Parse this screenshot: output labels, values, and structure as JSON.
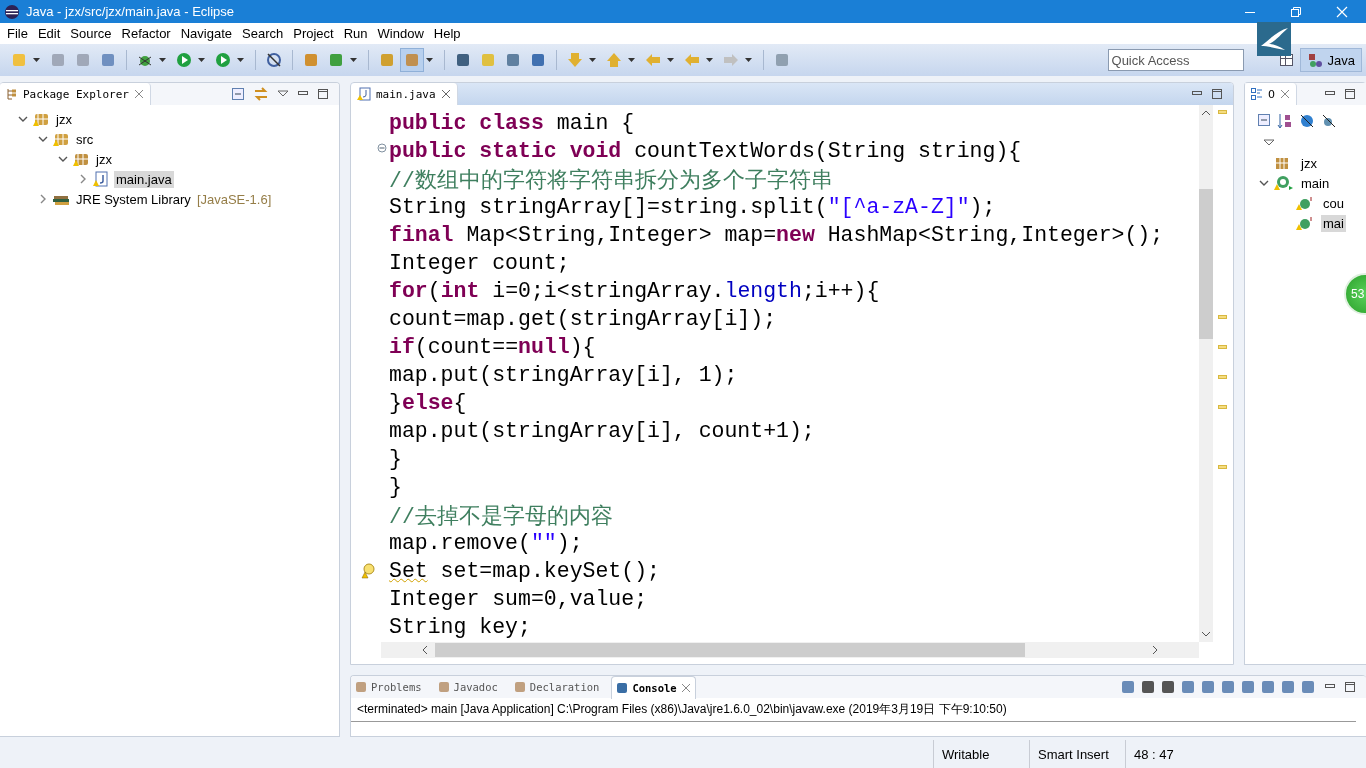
{
  "window": {
    "title": "Java - jzx/src/jzx/main.java - Eclipse"
  },
  "menu": [
    "File",
    "Edit",
    "Source",
    "Refactor",
    "Navigate",
    "Search",
    "Project",
    "Run",
    "Window",
    "Help"
  ],
  "quick_access": {
    "placeholder": "Quick Access"
  },
  "perspective": {
    "label": "Java",
    "selected": true
  },
  "package_explorer": {
    "tab": "Package Explorer",
    "tree": [
      {
        "label": "jzx",
        "kind": "project",
        "expanded": true,
        "selected": false,
        "children": [
          {
            "label": "src",
            "kind": "source-folder",
            "expanded": true,
            "selected": false,
            "children": [
              {
                "label": "jzx",
                "kind": "package",
                "expanded": true,
                "selected": false,
                "children": [
                  {
                    "label": "main.java",
                    "kind": "java-file",
                    "expanded": false,
                    "selected": true
                  }
                ]
              }
            ]
          },
          {
            "label": "JRE System Library",
            "suffix": "[JavaSE-1.6]",
            "kind": "library",
            "expanded": false,
            "selected": false
          }
        ]
      }
    ]
  },
  "editor": {
    "tab": "main.java",
    "lines": [
      {
        "tokens": [
          {
            "kind": "keyword",
            "text": "public class"
          },
          {
            "kind": "plain",
            "text": " main {"
          }
        ]
      },
      {
        "kind": "fold",
        "tokens": [
          {
            "kind": "keyword",
            "text": "public static void"
          },
          {
            "kind": "plain",
            "text": " countTextWords(String string){"
          }
        ]
      },
      {
        "tokens": [
          {
            "kind": "comment",
            "text": "//数组中的字符将字符串拆分为多个子字符串"
          }
        ]
      },
      {
        "tokens": [
          {
            "kind": "plain",
            "text": "String stringArray[]=string.split("
          },
          {
            "kind": "string",
            "text": "\"[^a-zA-Z]\""
          },
          {
            "kind": "plain",
            "text": ");"
          }
        ]
      },
      {
        "tokens": [
          {
            "kind": "keyword",
            "text": "final"
          },
          {
            "kind": "plain",
            "text": " Map<String,Integer> map="
          },
          {
            "kind": "keyword",
            "text": "new"
          },
          {
            "kind": "plain",
            "text": " HashMap<String,Integer>();"
          }
        ]
      },
      {
        "tokens": [
          {
            "kind": "plain",
            "text": "Integer count;"
          }
        ]
      },
      {
        "tokens": [
          {
            "kind": "keyword",
            "text": "for"
          },
          {
            "kind": "plain",
            "text": "("
          },
          {
            "kind": "keyword",
            "text": "int"
          },
          {
            "kind": "plain",
            "text": " i=0;i<stringArray."
          },
          {
            "kind": "field",
            "text": "length"
          },
          {
            "kind": "plain",
            "text": ";i++){"
          }
        ]
      },
      {
        "tokens": [
          {
            "kind": "plain",
            "text": "count=map.get(stringArray[i]);"
          }
        ]
      },
      {
        "tokens": [
          {
            "kind": "keyword",
            "text": "if"
          },
          {
            "kind": "plain",
            "text": "(count=="
          },
          {
            "kind": "keyword",
            "text": "null"
          },
          {
            "kind": "plain",
            "text": "){"
          }
        ]
      },
      {
        "tokens": [
          {
            "kind": "plain",
            "text": "map.put(stringArray[i], 1);"
          }
        ]
      },
      {
        "tokens": [
          {
            "kind": "plain",
            "text": "}"
          },
          {
            "kind": "keyword",
            "text": "else"
          },
          {
            "kind": "plain",
            "text": "{"
          }
        ]
      },
      {
        "tokens": [
          {
            "kind": "plain",
            "text": "map.put(stringArray[i], count+1);"
          }
        ]
      },
      {
        "tokens": [
          {
            "kind": "plain",
            "text": "}"
          }
        ]
      },
      {
        "tokens": [
          {
            "kind": "plain",
            "text": "}"
          }
        ]
      },
      {
        "tokens": [
          {
            "kind": "comment",
            "text": "//去掉不是字母的内容"
          }
        ]
      },
      {
        "tokens": [
          {
            "kind": "plain",
            "text": "map.remove("
          },
          {
            "kind": "string",
            "text": "\"\""
          },
          {
            "kind": "plain",
            "text": ");"
          }
        ]
      },
      {
        "kind": "warning",
        "tokens": [
          {
            "kind": "warned",
            "text": "Set"
          },
          {
            "kind": "plain",
            "text": " set=map.keySet();"
          }
        ]
      },
      {
        "tokens": [
          {
            "kind": "plain",
            "text": "Integer sum=0,value;"
          }
        ]
      },
      {
        "tokens": [
          {
            "kind": "plain",
            "text": "String key;"
          }
        ]
      }
    ]
  },
  "outline": {
    "tab": "0",
    "tree": [
      {
        "label": "jzx",
        "kind": "package",
        "selected": false
      },
      {
        "label": "main",
        "kind": "class",
        "expanded": true,
        "selected": false,
        "children": [
          {
            "label": "cou",
            "kind": "method",
            "selected": false
          },
          {
            "label": "mai",
            "kind": "method",
            "selected": true
          }
        ]
      }
    ]
  },
  "floating_badge": "53",
  "bottom_tabs": [
    {
      "label": "Problems",
      "selected": false
    },
    {
      "label": "Javadoc",
      "selected": false
    },
    {
      "label": "Declaration",
      "selected": false
    },
    {
      "label": "Console",
      "selected": true
    }
  ],
  "console": {
    "header": "<terminated> main [Java Application] C:\\Program Files (x86)\\Java\\jre1.6.0_02\\bin\\javaw.exe (2019年3月19日 下午9:10:50)"
  },
  "status_bar": [
    "Writable",
    "Smart Insert",
    "48 : 47"
  ]
}
